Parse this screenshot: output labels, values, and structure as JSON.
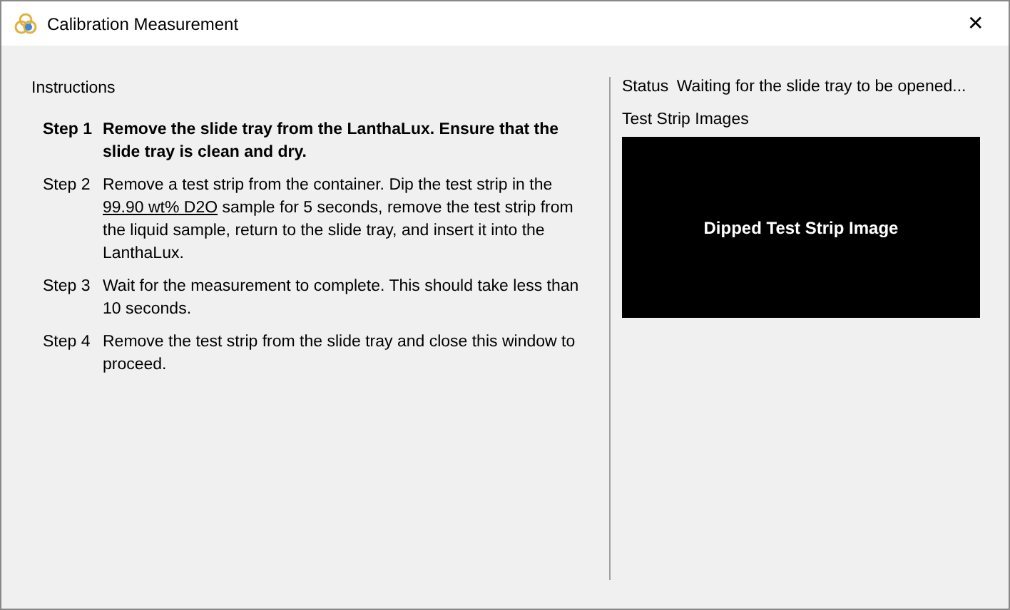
{
  "window": {
    "title": "Calibration Measurement",
    "close": "✕"
  },
  "instructions": {
    "title": "Instructions",
    "steps": [
      {
        "label": "Step 1",
        "selected": true,
        "parts": [
          {
            "text": "Remove the slide tray from the LanthaLux. Ensure that the slide tray is clean and dry."
          }
        ]
      },
      {
        "label": "Step 2",
        "selected": false,
        "parts": [
          {
            "text": "Remove a test strip from the container. Dip the test strip in the "
          },
          {
            "text": "99.90 wt% D2O",
            "kind": "link"
          },
          {
            "text": " sample for 5 seconds, remove the test strip from the liquid sample, return to the slide tray, and insert it into the LanthaLux."
          }
        ]
      },
      {
        "label": "Step 3",
        "selected": false,
        "parts": [
          {
            "text": "Wait for the measurement to complete. This should take less than 10 seconds."
          }
        ]
      },
      {
        "label": "Step 4",
        "selected": false,
        "parts": [
          {
            "text": "Remove the test strip from the slide tray and close this window to proceed."
          }
        ]
      }
    ]
  },
  "status": {
    "label": "Status",
    "value": "Waiting for the slide tray to be opened..."
  },
  "images": {
    "title": "Test Strip Images",
    "placeholder": "Dipped Test Strip Image"
  }
}
